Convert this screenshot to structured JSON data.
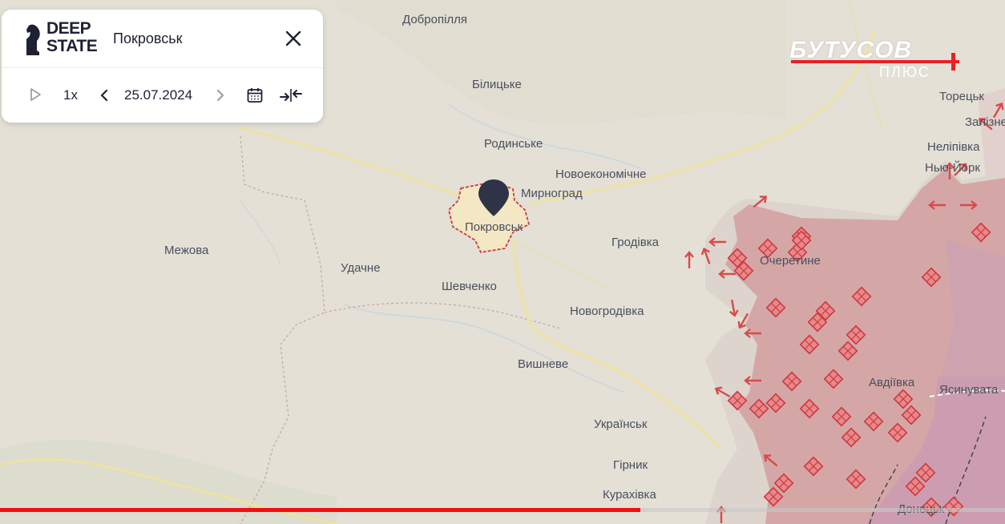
{
  "panel": {
    "logo_line1": "DEEP",
    "logo_line2": "STATE",
    "title": "Покровськ",
    "speed": "1x",
    "date": "25.07.2024",
    "icons": [
      "play-icon",
      "chevron-left-icon",
      "chevron-right-icon",
      "calendar-icon",
      "collapse-icon",
      "close-icon"
    ]
  },
  "brand": {
    "main": "БУТУСОВ",
    "sub": "ПЛЮС",
    "accent_color": "#e62227"
  },
  "map": {
    "colors": {
      "background": "#e4e0d6",
      "occupied_fill": "#d7aaa8",
      "occupied_dark": "#c99a9a",
      "occupied_long": "#c99ab3",
      "contested": "#d9d2c9",
      "road": "#f1e5a3",
      "marker": "#2f3348",
      "front_red": "#d94a4a"
    },
    "places": [
      "Добропілля",
      "Білицьке",
      "Родинське",
      "Новоекономічне",
      "Мирноград",
      "Покровськ",
      "Гродівка",
      "Межова",
      "Удачне",
      "Шевченко",
      "Новогродівка",
      "Вишневе",
      "Українськ",
      "Гірник",
      "Курахівка",
      "Очеретине",
      "Торецьк",
      "Залізне",
      "Неліпівка",
      "Нью-Йорк",
      "Авдіївка",
      "Ясинувата",
      "Донецьк"
    ]
  },
  "video": {
    "progress_fraction": 0.637
  }
}
